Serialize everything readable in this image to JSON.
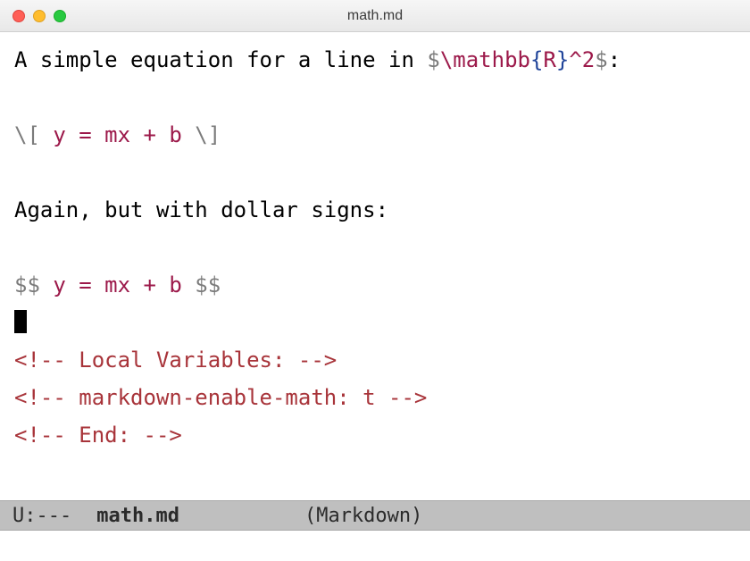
{
  "window": {
    "title": "math.md"
  },
  "lines": {
    "l1_pre": "A simple equation for a line in ",
    "l1_d1": "$",
    "l1_m1": "\\mathbb",
    "l1_b1": "{",
    "l1_m2": "R",
    "l1_b2": "}",
    "l1_m3": "^2",
    "l1_d2": "$",
    "l1_post": ":",
    "l2_d1": "\\[",
    "l2_mid": " y = mx + b ",
    "l2_d2": "\\]",
    "l3": "Again, but with dollar signs:",
    "l4_d1": "$$",
    "l4_mid": " y = mx + b ",
    "l4_d2": "$$",
    "c1": "<!-- Local Variables: -->",
    "c2": "<!-- markdown-enable-math: t -->",
    "c3": "<!-- End: -->"
  },
  "modeline": {
    "status": "U:---",
    "buffer": "math.md",
    "mode": "(Markdown)"
  }
}
